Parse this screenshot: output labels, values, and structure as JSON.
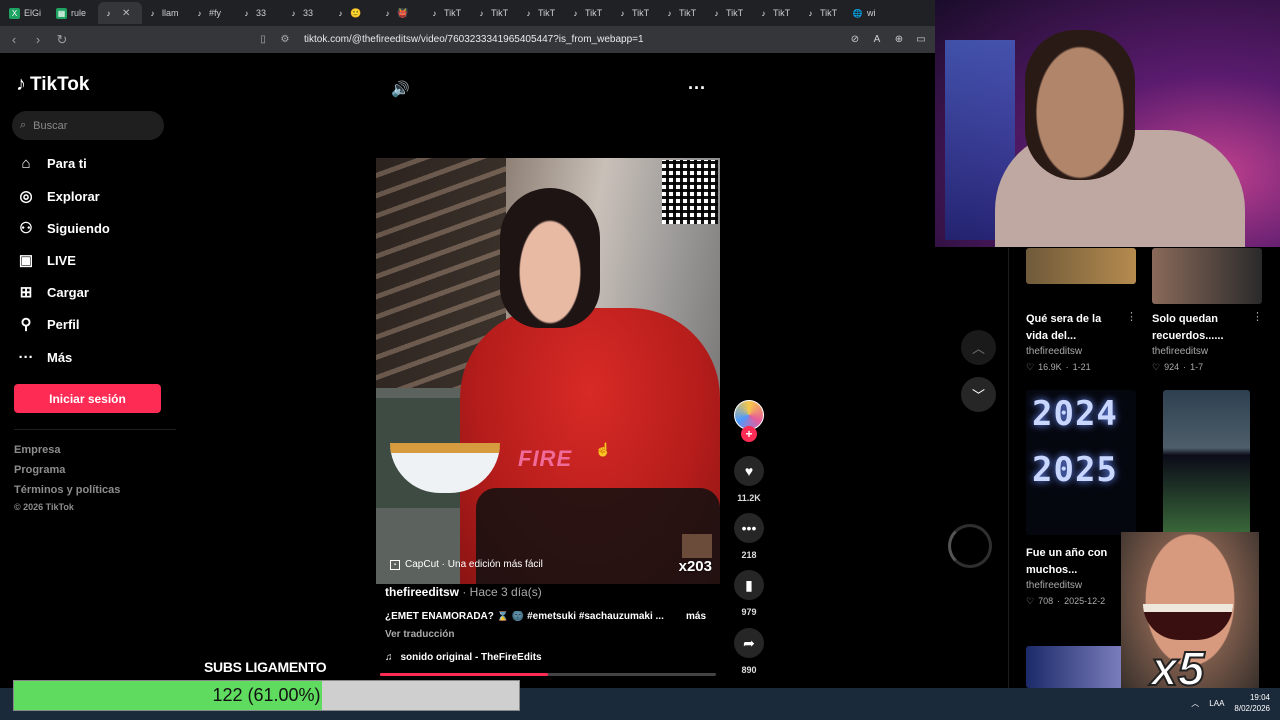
{
  "browser": {
    "tabs": [
      {
        "icon": "X",
        "label": "ElGi"
      },
      {
        "icon": "▦",
        "label": "rule"
      },
      {
        "icon": "♪",
        "label": "",
        "active": true
      },
      {
        "icon": "♪",
        "label": "llam"
      },
      {
        "icon": "♪",
        "label": "#fy"
      },
      {
        "icon": "♪",
        "label": "33"
      },
      {
        "icon": "♪",
        "label": "33"
      },
      {
        "icon": "♪",
        "label": "🙂"
      },
      {
        "icon": "♪",
        "label": "👹"
      },
      {
        "icon": "♪",
        "label": "TikT"
      },
      {
        "icon": "♪",
        "label": "TikT"
      },
      {
        "icon": "♪",
        "label": "TikT"
      },
      {
        "icon": "♪",
        "label": "TikT"
      },
      {
        "icon": "♪",
        "label": "TikT"
      },
      {
        "icon": "♪",
        "label": "TikT"
      },
      {
        "icon": "♪",
        "label": "TikT"
      },
      {
        "icon": "♪",
        "label": "TikT"
      },
      {
        "icon": "♪",
        "label": "TikT"
      },
      {
        "icon": "🌐",
        "label": "wi"
      }
    ],
    "url": "tiktok.com/@thefireeditsw/video/7603233341965405447?is_from_webapp=1"
  },
  "sidebar": {
    "brand": "TikTok",
    "search_placeholder": "Buscar",
    "nav": [
      "Para ti",
      "Explorar",
      "Siguiendo",
      "LIVE",
      "Cargar",
      "Perfil",
      "Más"
    ],
    "login": "Iniciar sesión",
    "footer": [
      "Empresa",
      "Programa",
      "Términos y políticas"
    ],
    "copyright": "© 2026 TikTok"
  },
  "video": {
    "overlay_text": "FIRE",
    "capcut": "CapCut · Una edición más fácil",
    "counter": "x203",
    "username": "thefireeditsw",
    "ago": " · Hace 3 día(s)",
    "description": "¿EMET ENAMORADA? ⌛ 🌚 #emetsuki #sachauzumaki ...",
    "more": "más",
    "translate": "Ver traducción",
    "sound_icon": "♫",
    "sound": "sonido original - TheFireEdits",
    "progress": 0.5
  },
  "actions": {
    "likes": "11.2K",
    "comments": "218",
    "saves": "979",
    "shares": "890"
  },
  "grid": {
    "cards": [
      {
        "title": "Qué sera de la vida del...",
        "user": "thefireeditsw",
        "views": "16.9K",
        "date": "1-21"
      },
      {
        "title": "Solo quedan recuerdos......",
        "user": "thefireeditsw",
        "views": "924",
        "date": "1-7"
      },
      {
        "title": "Fue un año con muchos...",
        "user": "thefireeditsw",
        "views": "708",
        "date": "2025-12-2"
      }
    ],
    "years": [
      "2024",
      "2025"
    ]
  },
  "meme": {
    "label": "x5"
  },
  "subs": {
    "label": "SUBS LIGAMENTO",
    "text": "122 (61.00%)",
    "fraction": 0.61
  },
  "taskbar": {
    "lang": "LAA",
    "time": "19:04",
    "date": "8/02/2026"
  },
  "colors": {
    "accent": "#fe2c55",
    "subs_fill": "#5fdb5f"
  }
}
